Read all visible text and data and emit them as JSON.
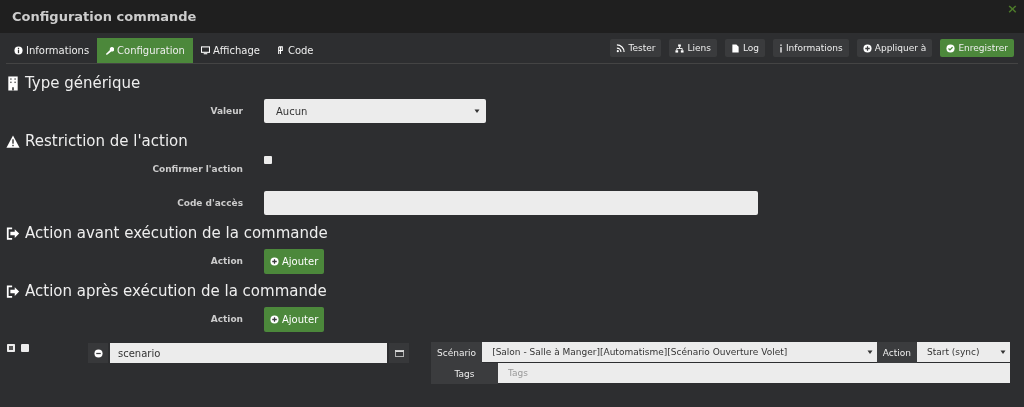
{
  "window": {
    "title": "Configuration commande",
    "close": "×"
  },
  "tabs": [
    {
      "label": "Informations",
      "selected": false
    },
    {
      "label": "Configuration",
      "selected": true
    },
    {
      "label": "Affichage",
      "selected": false
    },
    {
      "label": "Code",
      "selected": false
    }
  ],
  "toolbar": [
    {
      "label": "Tester",
      "primary": false
    },
    {
      "label": "Liens",
      "primary": false
    },
    {
      "label": "Log",
      "primary": false
    },
    {
      "label": "Informations",
      "primary": false
    },
    {
      "label": "Appliquer à",
      "primary": false
    },
    {
      "label": "Enregistrer",
      "primary": true
    }
  ],
  "sections": [
    {
      "title": "Type générique",
      "rows": [
        {
          "label": "Valeur",
          "kind": "select",
          "value": "Aucun"
        }
      ]
    },
    {
      "title": "Restriction de l'action",
      "rows": [
        {
          "label": "Confirmer l'action",
          "kind": "checkbox",
          "checked": false
        },
        {
          "label": "Code d'accès",
          "kind": "text",
          "value": ""
        }
      ]
    },
    {
      "title": "Action avant exécution de la commande",
      "rows": [
        {
          "label": "Action",
          "kind": "button",
          "button": "Ajouter"
        }
      ]
    },
    {
      "title": "Action après exécution de la commande",
      "rows": [
        {
          "label": "Action",
          "kind": "button",
          "button": "Ajouter"
        }
      ]
    }
  ],
  "action": {
    "enabled": true,
    "parallel": false,
    "command": "scenario",
    "scenario_label": "Scénario",
    "scenario": "[Salon - Salle à Manger][Automatisme][Scénario Ouverture Volet]",
    "action_label": "Action",
    "action": "Start (sync)",
    "tags_label": "Tags",
    "tags_placeholder": "Tags"
  }
}
